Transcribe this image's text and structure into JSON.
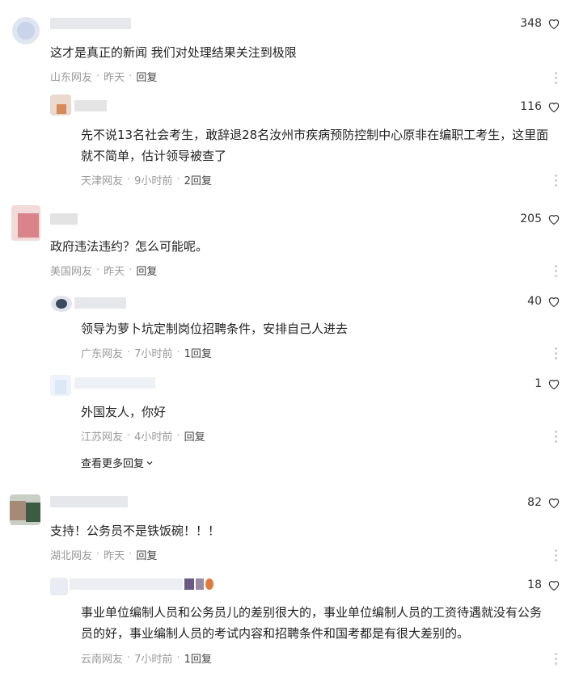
{
  "comments": [
    {
      "text": "这才是真正的新闻 我们对处理结果关注到极限",
      "likes": "348",
      "location": "山东网友",
      "time": "昨天",
      "reply": "回复"
    },
    {
      "text": "先不说13名社会考生，敢辞退28名汝州市疾病预防控制中心原非在编职工考生，这里面就不简单，估计领导被查了",
      "likes": "116",
      "location": "天津网友",
      "time": "9小时前",
      "reply": "2回复"
    },
    {
      "text": "政府违法违约？怎么可能呢。",
      "likes": "205",
      "location": "美国网友",
      "time": "昨天",
      "reply": "回复"
    },
    {
      "text": "领导为萝卜坑定制岗位招聘条件，安排自己人进去",
      "likes": "40",
      "location": "广东网友",
      "time": "7小时前",
      "reply": "1回复"
    },
    {
      "text": "外国友人，你好",
      "likes": "1",
      "location": "江苏网友",
      "time": "4小时前",
      "reply": "回复"
    },
    {
      "text": "支持！公务员不是铁饭碗！！！",
      "likes": "82",
      "location": "湖北网友",
      "time": "昨天",
      "reply": "回复"
    },
    {
      "text": "事业单位编制人员和公务员儿的差别很大的，事业单位编制人员的工资待遇就没有公务员的好，事业编制人员的考试内容和招聘条件和国考都是有很大差别的。",
      "likes": "18",
      "location": "云南网友",
      "time": "7小时前",
      "reply": "1回复"
    }
  ],
  "separator": "·",
  "show_more": "查看更多回复",
  "icons": {
    "like": "heart-outline-icon",
    "more": "more-vertical-icon",
    "expand": "chevron-down-icon"
  },
  "colors": {
    "text": "#222222",
    "meta": "#999999",
    "reply": "#444444"
  }
}
